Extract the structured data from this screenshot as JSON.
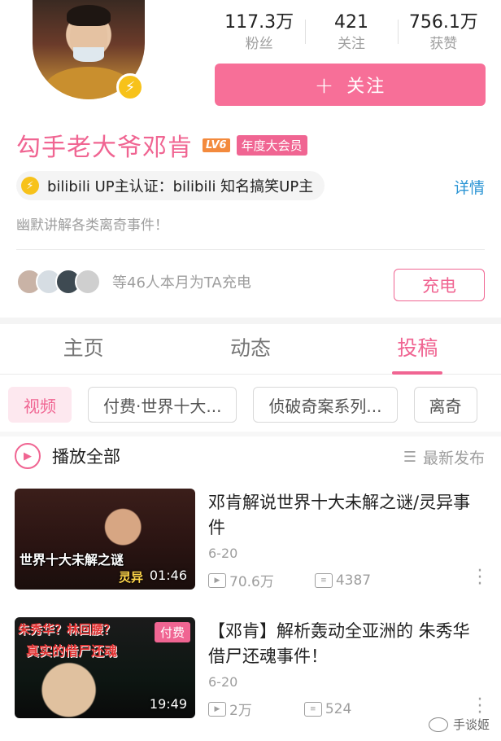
{
  "profile": {
    "name": "勾手老大爷邓肯",
    "level": "LV6",
    "vip_label": "年度大会员",
    "verify_text": "bilibili UP主认证：bilibili 知名搞笑UP主",
    "detail_link": "详情",
    "bio": "幽默讲解各类离奇事件！"
  },
  "stats": [
    {
      "value": "117.3万",
      "label": "粉丝"
    },
    {
      "value": "421",
      "label": "关注"
    },
    {
      "value": "756.1万",
      "label": "获赞"
    }
  ],
  "follow_button": {
    "icon": "+",
    "label": "关注"
  },
  "charge": {
    "text": "等46人本月为TA充电",
    "button_label": "充电",
    "supporter_colors": [
      "#c9b3a6",
      "#d6dde3",
      "#3e4a52",
      "#cfcfcf"
    ]
  },
  "tabs": [
    {
      "label": "主页",
      "active": false
    },
    {
      "label": "动态",
      "active": false
    },
    {
      "label": "投稿",
      "active": true
    }
  ],
  "chips": [
    "视频",
    "付费·世界十大...",
    "侦破奇案系列...",
    "离奇"
  ],
  "play_all_label": "播放全部",
  "sort_label": "最新发布",
  "videos": [
    {
      "title": "邓肯解说世界十大未解之谜/灵异事件",
      "date": "6-20",
      "duration": "01:46",
      "views": "70.6万",
      "comments": "4387",
      "paid": "",
      "thumb_caption": "世界十大未解之谜",
      "thumb_caption2": "灵异"
    },
    {
      "title": "【邓肯】解析轰动全亚洲的 朱秀华借尸还魂事件！",
      "date": "6-20",
      "duration": "19:49",
      "views": "2万",
      "comments": "524",
      "paid": "付费",
      "thumb_caption": "朱秀华？林回腰？",
      "thumb_caption2": "真实的借尸还魂"
    }
  ],
  "watermark": "手谈姬",
  "accent_color": "#f06592"
}
